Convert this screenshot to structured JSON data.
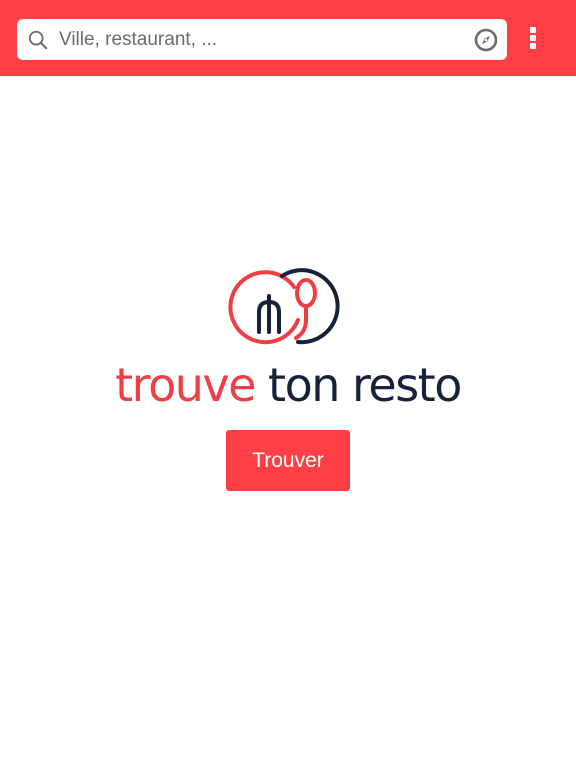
{
  "colors": {
    "brand_red": "#ff3f45",
    "logo_red": "#ef3e45",
    "logo_navy": "#16213a",
    "background": "#ffffff"
  },
  "search": {
    "placeholder": "Ville, restaurant, ...",
    "value": "",
    "search_icon": "search-icon",
    "locate_icon": "compass-icon"
  },
  "menu": {
    "icon": "kebab-menu-icon"
  },
  "logo": {
    "word_1": "trouve",
    "word_2": "ton resto",
    "mark_icon": "plate-fork-spoon-logo"
  },
  "actions": {
    "find_label": "Trouver"
  }
}
